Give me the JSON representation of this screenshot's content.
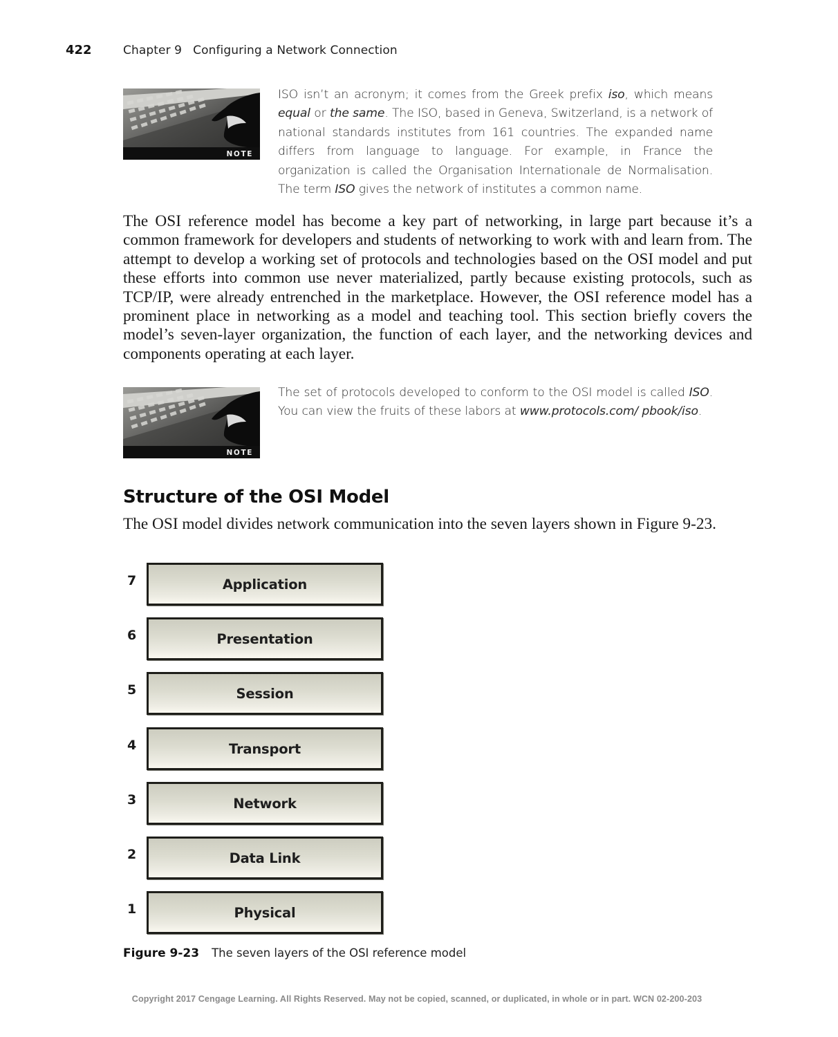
{
  "header": {
    "page_number": "422",
    "chapter": "Chapter 9",
    "chapter_title": "Configuring a Network Connection"
  },
  "notes": [
    {
      "image_label": "NOTE",
      "icon": "note-keyboard-hand-image",
      "segments": [
        {
          "text": "ISO isn’t an acronym; it comes from the Greek prefix ",
          "italic": false
        },
        {
          "text": "iso",
          "italic": true
        },
        {
          "text": ", which means ",
          "italic": false
        },
        {
          "text": "equal",
          "italic": true
        },
        {
          "text": " or ",
          "italic": false
        },
        {
          "text": "the same",
          "italic": true
        },
        {
          "text": ". The ISO, based in Geneva, Switzerland, is a network of national standards institutes from 161 countries. The expanded name differs from language to language. For example, in France the organization is called the Organisation Internationale de Normalisation. The term ",
          "italic": false
        },
        {
          "text": "ISO",
          "italic": true
        },
        {
          "text": " gives the network of institutes a common name.",
          "italic": false
        }
      ]
    },
    {
      "image_label": "NOTE",
      "icon": "note-keyboard-hand-image",
      "segments": [
        {
          "text": "The set of protocols developed to conform to the OSI model is called ",
          "italic": false
        },
        {
          "text": "ISO",
          "italic": true
        },
        {
          "text": ". You can view the fruits of these labors at ",
          "italic": false
        },
        {
          "text": "www.protocols.com/ pbook/iso",
          "italic": true
        },
        {
          "text": ".",
          "italic": false
        }
      ]
    }
  ],
  "body_paragraph": "The OSI reference model has become a key part of networking, in large part because it’s a common framework for developers and students of networking to work with and learn from. The attempt to develop a working set of protocols and technologies based on the OSI model and put these efforts into common use never materialized, partly because existing protocols, such as TCP/IP, were already entrenched in the marketplace. However, the OSI reference model has a prominent place in networking as a model and teaching tool. This section briefly covers the model’s seven-layer organization, the function of each layer, and the networking devices and components operating at each layer.",
  "section": {
    "heading": "Structure of the OSI Model",
    "intro": "The OSI model divides network communication into the seven layers shown in Figure 9-23."
  },
  "figure": {
    "layers": [
      {
        "number": "7",
        "name": "Application"
      },
      {
        "number": "6",
        "name": "Presentation"
      },
      {
        "number": "5",
        "name": "Session"
      },
      {
        "number": "4",
        "name": "Transport"
      },
      {
        "number": "3",
        "name": "Network"
      },
      {
        "number": "2",
        "name": "Data Link"
      },
      {
        "number": "1",
        "name": "Physical"
      }
    ],
    "caption_number": "Figure 9-23",
    "caption_text": "The seven layers of the OSI reference model"
  },
  "footer": {
    "copyright": "Copyright 2017 Cengage Learning. All Rights Reserved. May not be copied, scanned, or duplicated, in whole or in part.  WCN 02-200-203"
  }
}
